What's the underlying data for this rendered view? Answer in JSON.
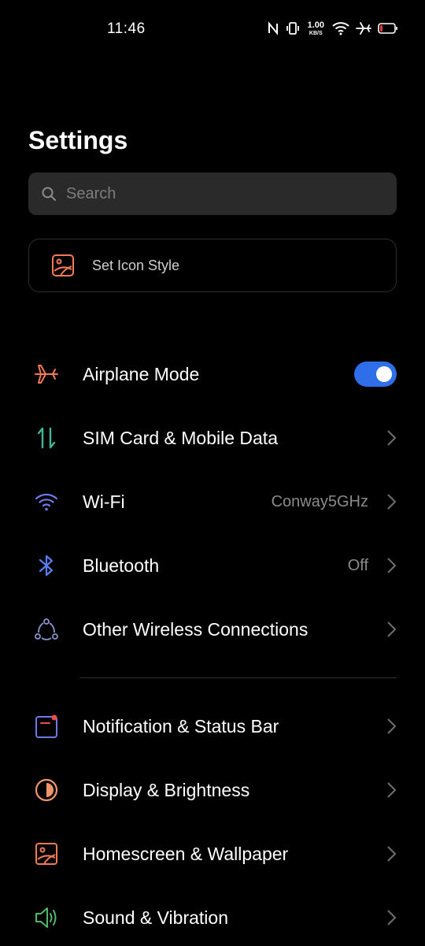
{
  "status_bar": {
    "time": "11:46",
    "net_speed_value": "1.00",
    "net_speed_unit": "KB/S",
    "icons": [
      "nfc-icon",
      "vibrate-icon",
      "wifi-icon",
      "airplane-icon",
      "battery-icon"
    ]
  },
  "header": {
    "title": "Settings"
  },
  "search": {
    "placeholder": "Search",
    "icon": "search-icon"
  },
  "icon_style_card": {
    "label": "Set Icon Style",
    "icon": "image-icon",
    "accent": "#f07b55"
  },
  "sections": [
    {
      "items": [
        {
          "id": "airplane",
          "label": "Airplane Mode",
          "icon": "airplane-icon",
          "icon_color": "#f07b55",
          "toggle": true,
          "toggle_on": true
        },
        {
          "id": "sim",
          "label": "SIM Card & Mobile Data",
          "icon": "data-transfer-icon",
          "icon_color": "#3fb89a"
        },
        {
          "id": "wifi",
          "label": "Wi-Fi",
          "value": "Conway5GHz",
          "icon": "wifi-icon",
          "icon_color": "#6f78e8"
        },
        {
          "id": "bluetooth",
          "label": "Bluetooth",
          "value": "Off",
          "icon": "bluetooth-icon",
          "icon_color": "#5b7cf0"
        },
        {
          "id": "other-wireless",
          "label": "Other Wireless Connections",
          "icon": "connections-icon",
          "icon_color": "#8a93c8"
        }
      ]
    },
    {
      "items": [
        {
          "id": "notification",
          "label": "Notification & Status Bar",
          "icon": "notification-icon",
          "icon_color": "#6f78e8",
          "badge_color": "#f04b4b"
        },
        {
          "id": "display",
          "label": "Display & Brightness",
          "icon": "brightness-icon",
          "icon_color": "#f0956a"
        },
        {
          "id": "homescreen",
          "label": "Homescreen & Wallpaper",
          "icon": "wallpaper-icon",
          "icon_color": "#f07b55"
        },
        {
          "id": "sound",
          "label": "Sound & Vibration",
          "icon": "speaker-icon",
          "icon_color": "#4fb86a"
        }
      ]
    }
  ],
  "colors": {
    "background": "#000000",
    "search_bg": "#2a2a2a",
    "toggle_on": "#2f6ee9",
    "secondary_text": "#8a8a8a",
    "chevron": "#6e6e6e"
  }
}
